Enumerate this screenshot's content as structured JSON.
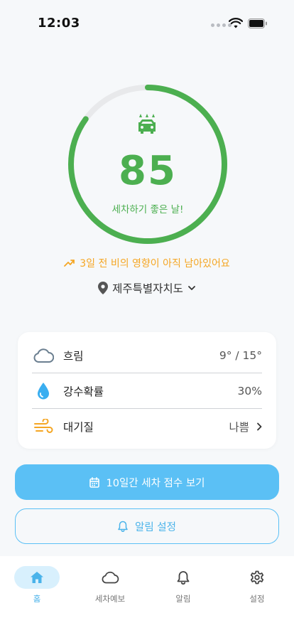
{
  "status_bar": {
    "time": "12:03"
  },
  "score": {
    "value": "85",
    "percent": 85,
    "caption": "세차하기 좋은 날!",
    "ring_color": "#4caf50",
    "track_color": "#e8e9eb"
  },
  "rain_note": "3일 전 비의 영향이 아직 남아있어요",
  "location": {
    "name": "제주특별자치도"
  },
  "weather": {
    "sky": {
      "label": "흐림",
      "value": "9° / 15°",
      "icon": "cloud-icon"
    },
    "rain": {
      "label": "강수확률",
      "value": "30%",
      "icon": "water-drop-icon"
    },
    "air": {
      "label": "대기질",
      "value": "나쁨",
      "icon": "wind-icon"
    }
  },
  "buttons": {
    "forecast": "10일간 세차 점수 보기",
    "alarm": "알림 설정"
  },
  "tabs": [
    {
      "label": "홈",
      "icon": "home-icon",
      "active": true
    },
    {
      "label": "세차예보",
      "icon": "cloud-icon",
      "active": false
    },
    {
      "label": "알림",
      "icon": "bell-icon",
      "active": false
    },
    {
      "label": "설정",
      "icon": "gear-icon",
      "active": false
    }
  ],
  "colors": {
    "accent": "#5bc0f5",
    "score_green": "#4caf50",
    "warning_orange": "#f5a623"
  }
}
